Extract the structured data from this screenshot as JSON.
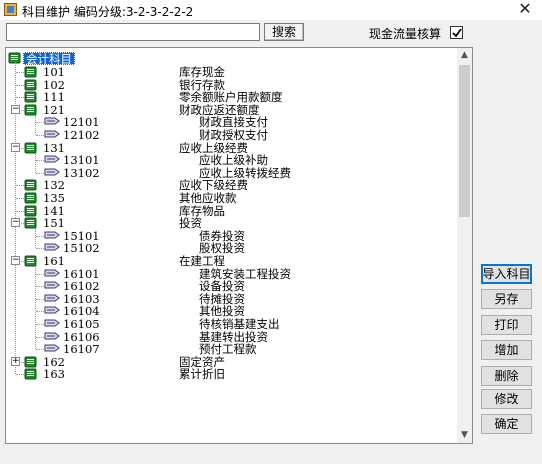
{
  "window": {
    "title": "科目维护   编码分级:3-2-3-2-2-2",
    "close_glyph": "✕"
  },
  "toolbar": {
    "search_value": "",
    "search_button": "搜索",
    "cashflow_label": "现金流量核算",
    "cashflow_checked": true
  },
  "tree": {
    "root_label": "会计科目",
    "rows": [
      {
        "code": "101",
        "name": "库存现金",
        "level": 1
      },
      {
        "code": "102",
        "name": "银行存款",
        "level": 1
      },
      {
        "code": "111",
        "name": "零余额账户用款额度",
        "level": 1
      },
      {
        "code": "121",
        "name": "财政应返还额度",
        "level": 1,
        "expand": "−"
      },
      {
        "code": "12101",
        "name": "财政直接支付",
        "level": 2
      },
      {
        "code": "12102",
        "name": "财政授权支付",
        "level": 2
      },
      {
        "code": "131",
        "name": "应收上级经费",
        "level": 1,
        "expand": "−"
      },
      {
        "code": "13101",
        "name": "应收上级补助",
        "level": 2
      },
      {
        "code": "13102",
        "name": "应收上级转拨经费",
        "level": 2
      },
      {
        "code": "132",
        "name": "应收下级经费",
        "level": 1
      },
      {
        "code": "135",
        "name": "其他应收款",
        "level": 1
      },
      {
        "code": "141",
        "name": "库存物品",
        "level": 1
      },
      {
        "code": "151",
        "name": "投资",
        "level": 1,
        "expand": "−"
      },
      {
        "code": "15101",
        "name": "债券投资",
        "level": 2
      },
      {
        "code": "15102",
        "name": "股权投资",
        "level": 2
      },
      {
        "code": "161",
        "name": "在建工程",
        "level": 1,
        "expand": "−"
      },
      {
        "code": "16101",
        "name": "建筑安装工程投资",
        "level": 2
      },
      {
        "code": "16102",
        "name": "设备投资",
        "level": 2
      },
      {
        "code": "16103",
        "name": "待摊投资",
        "level": 2
      },
      {
        "code": "16104",
        "name": "其他投资",
        "level": 2
      },
      {
        "code": "16105",
        "name": "待核销基建支出",
        "level": 2
      },
      {
        "code": "16106",
        "name": "基建转出投资",
        "level": 2
      },
      {
        "code": "16107",
        "name": "预付工程款",
        "level": 2
      },
      {
        "code": "162",
        "name": "固定资产",
        "level": 1,
        "expand": "+"
      },
      {
        "code": "163",
        "name": "累计折旧",
        "level": 1
      }
    ]
  },
  "buttons": {
    "import": "导入科目",
    "save_as": "另存",
    "print": "打印",
    "add": "增加",
    "delete": "删除",
    "edit": "修改",
    "ok": "确定"
  },
  "colors": {
    "selection": "#0a64d6",
    "book_icon_green": "#1f8a2a"
  },
  "icons": {
    "app": "ledger-app-icon",
    "folder_node": "green-book-icon",
    "leaf_node": "pen-icon"
  }
}
